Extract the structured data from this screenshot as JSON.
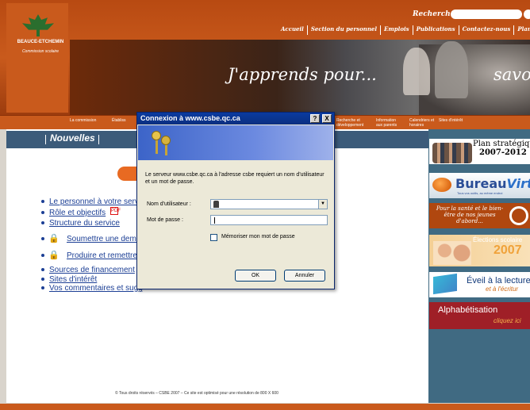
{
  "header": {
    "logo_name": "BEAUCE-ETCHEMIN",
    "logo_sub": "Commission scolaire",
    "search_label": "Recherche",
    "topnav": [
      "Accueil",
      "Section du personnel",
      "Emplois",
      "Publications",
      "Contactez-nous",
      "Plan du si"
    ],
    "tagline_left": "J'apprends pour...",
    "tagline_right": "savoir",
    "subnav": [
      "La commission",
      "Établiss",
      "Recherche et développement",
      "Information aux parents",
      "Calendriers et horaires",
      "Sites d'intérêt"
    ]
  },
  "main": {
    "section_title": "Nouvelles",
    "links": [
      "Le personnel à votre servi",
      "Rôle et objectifs",
      "Structure du service",
      "Soumettre une dema",
      "Produire et remettre",
      "Sources de financement",
      "Sites d'intérêt",
      "Vos commentaires et sugg"
    ],
    "footer": "© Tous droits réservés – CSBE 2007 – Ce site est optimisé pour une résolution de 800 X 600"
  },
  "promos": {
    "plan_line1": "Plan stratégique",
    "plan_line2": "2007-2012",
    "bureau_part1": "Bureau",
    "bureau_part2": "Virtue",
    "bureau_sub": "Tous vos outils, au même endroi",
    "sante": "Pour la santé et le bien-être de nos jeunes d'abord...",
    "elections_line1": "Élections scolaire",
    "elections_year": "2007",
    "lecture_line1": "Éveil à la lecture",
    "lecture_line2": "et à l'écritur",
    "alpha_line1": "Alphabétisation",
    "alpha_line2": "cliquez ici"
  },
  "dialog": {
    "title": "Connexion à www.csbe.qc.ca",
    "help_btn": "?",
    "close_btn": "X",
    "message": "Le serveur www.csbe.qc.ca à l'adresse csbe requiert un nom d'utilisateur et un mot de passe.",
    "user_label": "Nom d'utilisateur :",
    "password_label": "Mot de passe :",
    "remember_label": "Mémoriser mon mot de passe",
    "ok": "OK",
    "cancel": "Annuler"
  }
}
